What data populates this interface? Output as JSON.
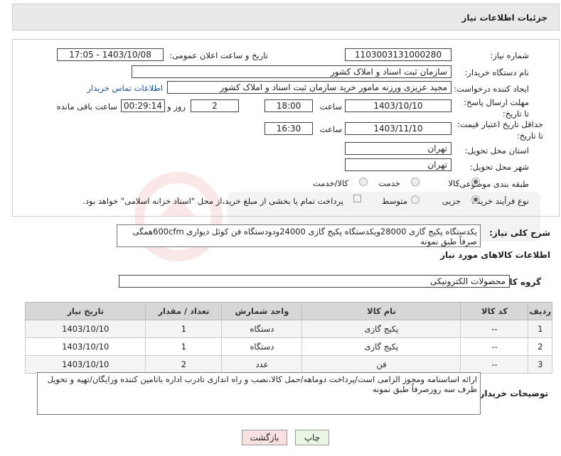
{
  "header": {
    "title": "جزئیات اطلاعات نیاز"
  },
  "form": {
    "need_number": {
      "label": "شماره نیاز:",
      "value": "1103003131000280"
    },
    "announce_datetime": {
      "label": "تاریخ و ساعت اعلان عمومی:",
      "value": "1403/10/08 - 17:05"
    },
    "buyer_org": {
      "label": "نام دستگاه خریدار:",
      "value": "سازمان ثبت اسناد و املاک کشور"
    },
    "requester": {
      "label": "ایجاد کننده درخواست:",
      "value": "مجید عزیزی ورزنه مامور خرید سازمان ثبت اسناد و املاک کشور",
      "contact_link": "اطلاعات تماس خریدار"
    },
    "reply_deadline": {
      "label": "مهلت ارسال پاسخ: تا تاریخ:",
      "date": "1403/10/10",
      "time_label": "ساعت",
      "time": "18:00",
      "days": "2",
      "days_label": "روز و",
      "remaining": "00:29:14",
      "remaining_label": "ساعت باقی مانده"
    },
    "price_validity": {
      "label": "حداقل تاریخ اعتبار قیمت: تا تاریخ:",
      "date": "1403/11/10",
      "time_label": "ساعت",
      "time": "16:30"
    },
    "delivery_province": {
      "label": "استان محل تحویل:",
      "value": "تهران"
    },
    "delivery_city": {
      "label": "شهر محل تحویل:",
      "value": "تهران"
    },
    "category": {
      "label": "طبقه بندی موضوعی:",
      "options": [
        "کالا",
        "خدمت",
        "کالا/خدمت"
      ],
      "selected": "کالا"
    },
    "purchase_process": {
      "label": "نوع فرآیند خرید :",
      "options": [
        "جزیی",
        "متوسط"
      ],
      "selected": "جزیی",
      "note": "پرداخت تمام یا بخشی از مبلغ خرید،از محل \"اسناد خزانه اسلامی\" خواهد بود."
    }
  },
  "summary": {
    "label": "شرح کلی نیاز:",
    "text": "یکدستگاه پکیج گازی 28000ویکدستگاه پکیج گازی 24000ودودستگاه فن کوئل دیواری 600cfmهمگی صرفاً طبق نمونه"
  },
  "goods_section": {
    "title": "اطلاعات کالاهای مورد نیاز",
    "group_label": "گروه کالا:",
    "group_value": "محصولات الکترونیکی"
  },
  "table": {
    "headers": [
      "ردیف",
      "کد کالا",
      "نام کالا",
      "واحد شمارش",
      "تعداد / مقدار",
      "تاریخ نیاز"
    ],
    "rows": [
      [
        "1",
        "--",
        "پکیج گازی",
        "دستگاه",
        "1",
        "1403/10/10"
      ],
      [
        "2",
        "--",
        "پکیج گازی",
        "دستگاه",
        "1",
        "1403/10/10"
      ],
      [
        "3",
        "--",
        "فن",
        "عدد",
        "2",
        "1403/10/10"
      ]
    ]
  },
  "buyer_notes": {
    "label": "توضیحات خریدار:",
    "text": "ارائه اساسنامه ومجوز الزامی است/پرداخت دوماهه/حمل کالا،نصب و راه اندازی تادرب اداره باتامین کننده ورایگان/تهیه و تحویل ظرف سه روزصرفاً طبق نمونه"
  },
  "buttons": {
    "print": "چاپ",
    "back": "بازگشت"
  }
}
